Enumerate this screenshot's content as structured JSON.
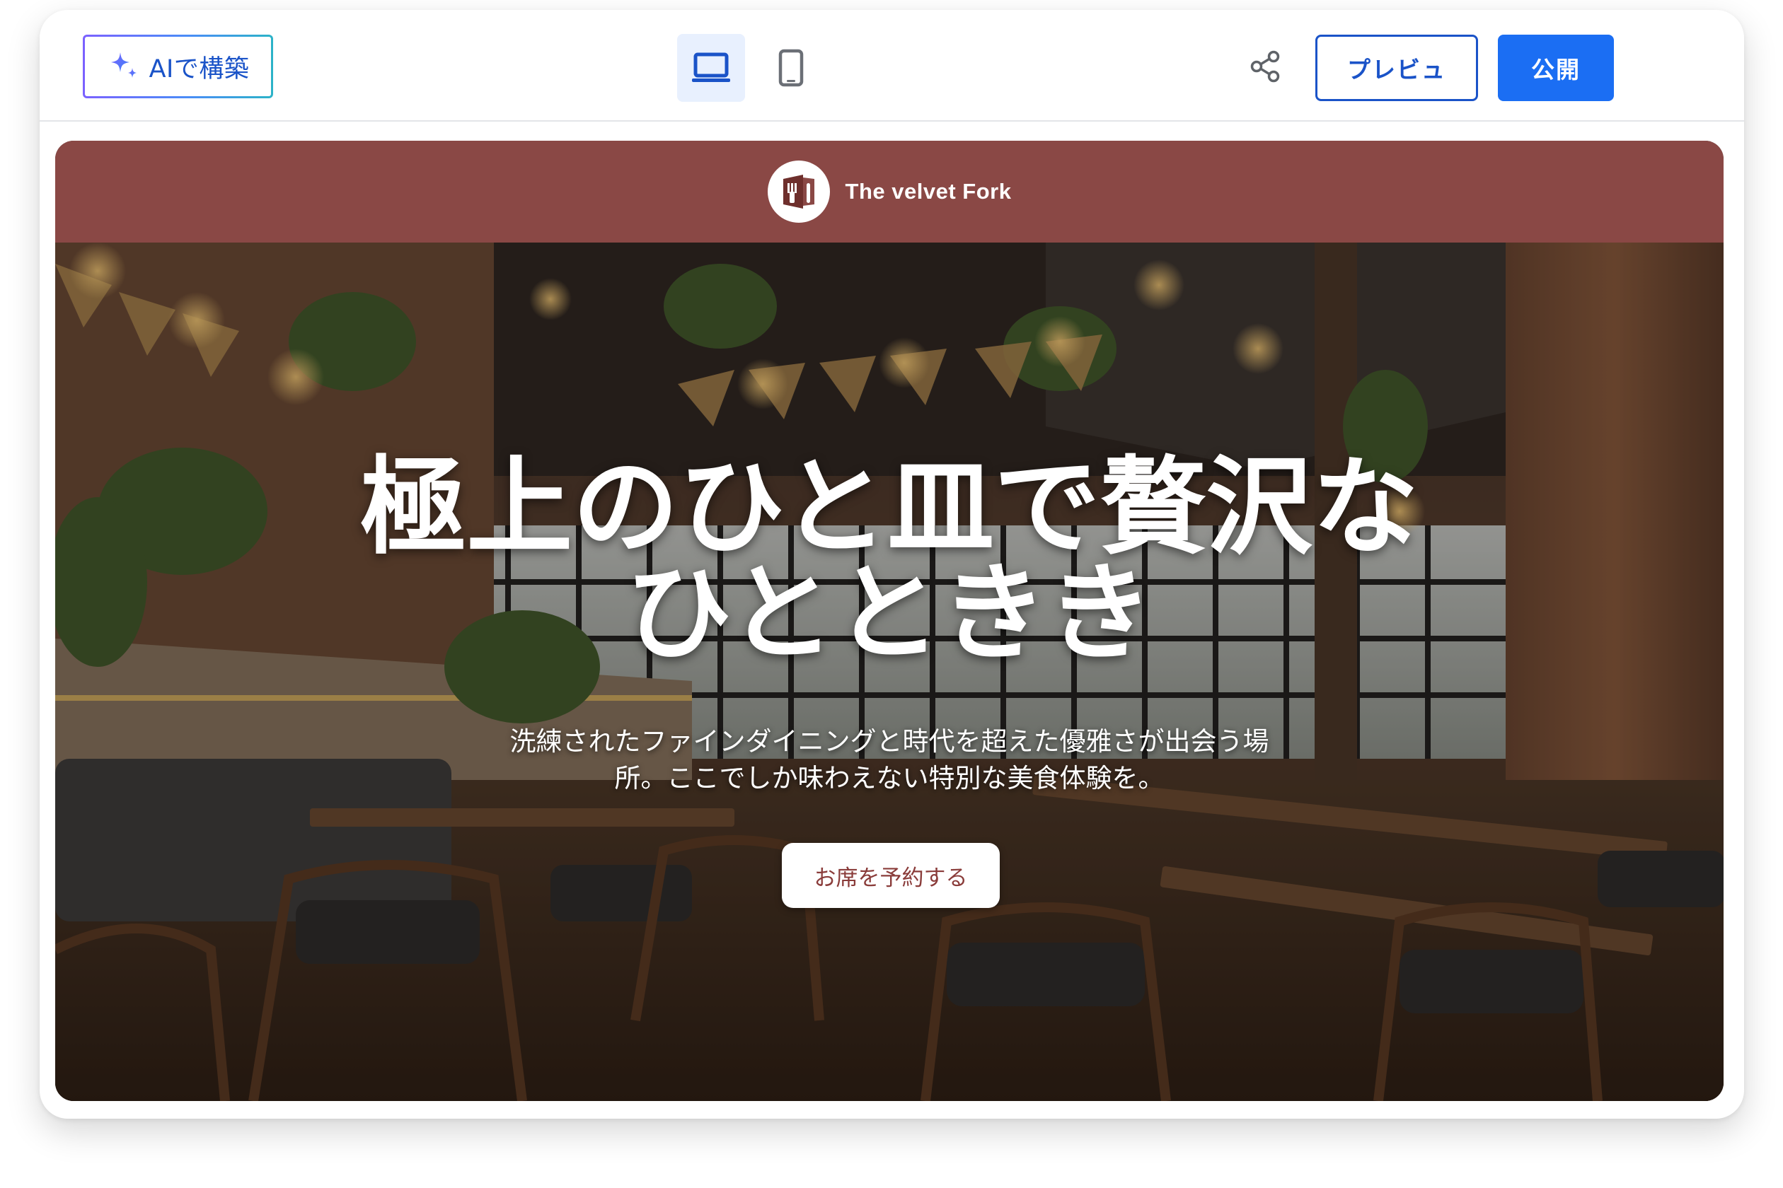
{
  "toolbar": {
    "ai_build_label": "AIで構築",
    "ai_icon": "sparkle-icon",
    "devices": [
      {
        "name": "desktop",
        "icon": "laptop-icon",
        "active": true
      },
      {
        "name": "mobile",
        "icon": "phone-icon",
        "active": false
      }
    ],
    "share_icon": "share-icon",
    "preview_label": "プレビュ",
    "publish_label": "公開"
  },
  "site": {
    "brand_name": "The velvet Fork",
    "logo_icon": "restaurant-logo-icon",
    "header_color": "#8a4845",
    "headline_line1": "極上のひと皿で贅沢な",
    "headline_line2": "ひとときき",
    "subtitle_line1": "洗練されたファインダイニングと時代を超えた優雅さが出会う場",
    "subtitle_line2": "所。ここでしか味わえない特別な美食体験を。",
    "cta_label": "お席を予約する"
  },
  "colors": {
    "accent_blue": "#1b6ef3",
    "link_blue": "#1a53c8",
    "cta_text": "#8a3c3a"
  }
}
